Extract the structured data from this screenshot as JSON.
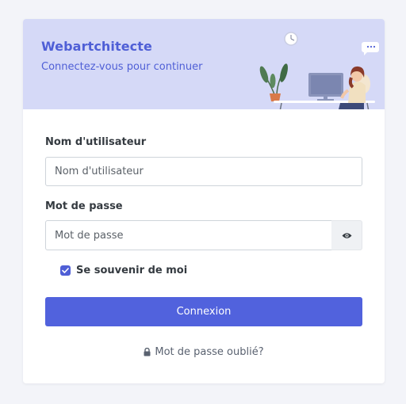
{
  "header": {
    "brand": "Webartchitecte",
    "subtitle": "Connectez-vous pour continuer"
  },
  "form": {
    "username": {
      "label": "Nom d'utilisateur",
      "placeholder": "Nom d'utilisateur",
      "value": ""
    },
    "password": {
      "label": "Mot de passe",
      "placeholder": "Mot de passe",
      "value": "",
      "toggle_icon": "eye-icon"
    },
    "remember": {
      "label": "Se souvenir de moi",
      "checked": true
    },
    "submit_label": "Connexion",
    "forgot": {
      "label": "Mot de passe oublié?",
      "icon": "lock-icon"
    }
  },
  "colors": {
    "accent": "#5162dd",
    "header_bg": "#d5d9f7",
    "brand_text": "#4f5fd6",
    "page_bg": "#f3f4f9"
  }
}
